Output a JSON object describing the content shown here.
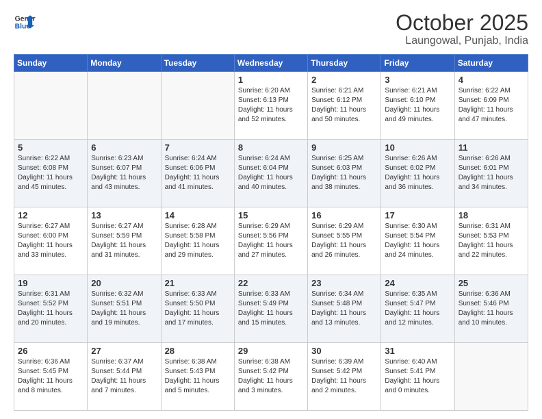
{
  "logo": {
    "line1": "General",
    "line2": "Blue"
  },
  "title": "October 2025",
  "location": "Laungowal, Punjab, India",
  "weekdays": [
    "Sunday",
    "Monday",
    "Tuesday",
    "Wednesday",
    "Thursday",
    "Friday",
    "Saturday"
  ],
  "weeks": [
    [
      {
        "day": "",
        "info": ""
      },
      {
        "day": "",
        "info": ""
      },
      {
        "day": "",
        "info": ""
      },
      {
        "day": "1",
        "info": "Sunrise: 6:20 AM\nSunset: 6:13 PM\nDaylight: 11 hours\nand 52 minutes."
      },
      {
        "day": "2",
        "info": "Sunrise: 6:21 AM\nSunset: 6:12 PM\nDaylight: 11 hours\nand 50 minutes."
      },
      {
        "day": "3",
        "info": "Sunrise: 6:21 AM\nSunset: 6:10 PM\nDaylight: 11 hours\nand 49 minutes."
      },
      {
        "day": "4",
        "info": "Sunrise: 6:22 AM\nSunset: 6:09 PM\nDaylight: 11 hours\nand 47 minutes."
      }
    ],
    [
      {
        "day": "5",
        "info": "Sunrise: 6:22 AM\nSunset: 6:08 PM\nDaylight: 11 hours\nand 45 minutes."
      },
      {
        "day": "6",
        "info": "Sunrise: 6:23 AM\nSunset: 6:07 PM\nDaylight: 11 hours\nand 43 minutes."
      },
      {
        "day": "7",
        "info": "Sunrise: 6:24 AM\nSunset: 6:06 PM\nDaylight: 11 hours\nand 41 minutes."
      },
      {
        "day": "8",
        "info": "Sunrise: 6:24 AM\nSunset: 6:04 PM\nDaylight: 11 hours\nand 40 minutes."
      },
      {
        "day": "9",
        "info": "Sunrise: 6:25 AM\nSunset: 6:03 PM\nDaylight: 11 hours\nand 38 minutes."
      },
      {
        "day": "10",
        "info": "Sunrise: 6:26 AM\nSunset: 6:02 PM\nDaylight: 11 hours\nand 36 minutes."
      },
      {
        "day": "11",
        "info": "Sunrise: 6:26 AM\nSunset: 6:01 PM\nDaylight: 11 hours\nand 34 minutes."
      }
    ],
    [
      {
        "day": "12",
        "info": "Sunrise: 6:27 AM\nSunset: 6:00 PM\nDaylight: 11 hours\nand 33 minutes."
      },
      {
        "day": "13",
        "info": "Sunrise: 6:27 AM\nSunset: 5:59 PM\nDaylight: 11 hours\nand 31 minutes."
      },
      {
        "day": "14",
        "info": "Sunrise: 6:28 AM\nSunset: 5:58 PM\nDaylight: 11 hours\nand 29 minutes."
      },
      {
        "day": "15",
        "info": "Sunrise: 6:29 AM\nSunset: 5:56 PM\nDaylight: 11 hours\nand 27 minutes."
      },
      {
        "day": "16",
        "info": "Sunrise: 6:29 AM\nSunset: 5:55 PM\nDaylight: 11 hours\nand 26 minutes."
      },
      {
        "day": "17",
        "info": "Sunrise: 6:30 AM\nSunset: 5:54 PM\nDaylight: 11 hours\nand 24 minutes."
      },
      {
        "day": "18",
        "info": "Sunrise: 6:31 AM\nSunset: 5:53 PM\nDaylight: 11 hours\nand 22 minutes."
      }
    ],
    [
      {
        "day": "19",
        "info": "Sunrise: 6:31 AM\nSunset: 5:52 PM\nDaylight: 11 hours\nand 20 minutes."
      },
      {
        "day": "20",
        "info": "Sunrise: 6:32 AM\nSunset: 5:51 PM\nDaylight: 11 hours\nand 19 minutes."
      },
      {
        "day": "21",
        "info": "Sunrise: 6:33 AM\nSunset: 5:50 PM\nDaylight: 11 hours\nand 17 minutes."
      },
      {
        "day": "22",
        "info": "Sunrise: 6:33 AM\nSunset: 5:49 PM\nDaylight: 11 hours\nand 15 minutes."
      },
      {
        "day": "23",
        "info": "Sunrise: 6:34 AM\nSunset: 5:48 PM\nDaylight: 11 hours\nand 13 minutes."
      },
      {
        "day": "24",
        "info": "Sunrise: 6:35 AM\nSunset: 5:47 PM\nDaylight: 11 hours\nand 12 minutes."
      },
      {
        "day": "25",
        "info": "Sunrise: 6:36 AM\nSunset: 5:46 PM\nDaylight: 11 hours\nand 10 minutes."
      }
    ],
    [
      {
        "day": "26",
        "info": "Sunrise: 6:36 AM\nSunset: 5:45 PM\nDaylight: 11 hours\nand 8 minutes."
      },
      {
        "day": "27",
        "info": "Sunrise: 6:37 AM\nSunset: 5:44 PM\nDaylight: 11 hours\nand 7 minutes."
      },
      {
        "day": "28",
        "info": "Sunrise: 6:38 AM\nSunset: 5:43 PM\nDaylight: 11 hours\nand 5 minutes."
      },
      {
        "day": "29",
        "info": "Sunrise: 6:38 AM\nSunset: 5:42 PM\nDaylight: 11 hours\nand 3 minutes."
      },
      {
        "day": "30",
        "info": "Sunrise: 6:39 AM\nSunset: 5:42 PM\nDaylight: 11 hours\nand 2 minutes."
      },
      {
        "day": "31",
        "info": "Sunrise: 6:40 AM\nSunset: 5:41 PM\nDaylight: 11 hours\nand 0 minutes."
      },
      {
        "day": "",
        "info": ""
      }
    ]
  ]
}
